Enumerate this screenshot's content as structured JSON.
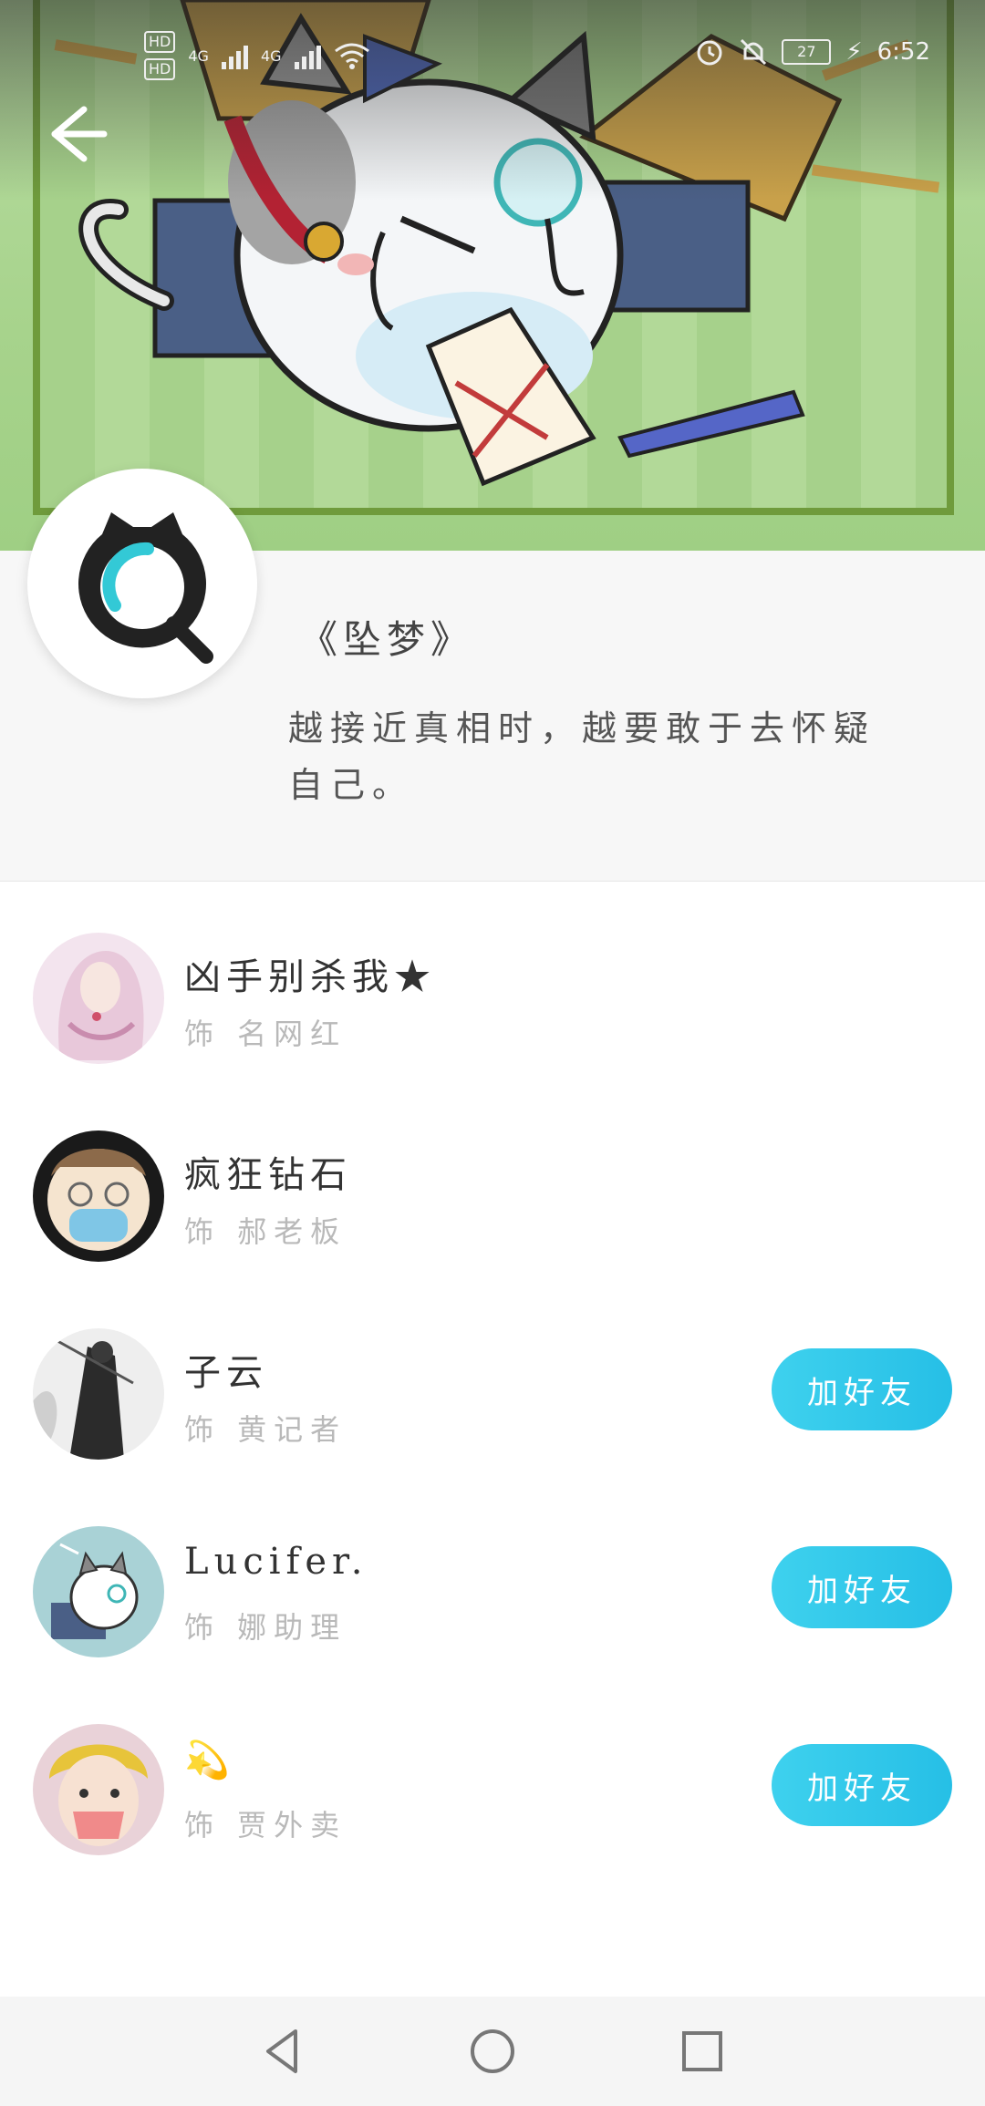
{
  "status_bar": {
    "hd1": "HD",
    "hd2": "HD",
    "net1": "4G",
    "net2": "4G",
    "battery": "27",
    "time": "6:52"
  },
  "header": {
    "back_icon": "back-arrow-icon"
  },
  "drama": {
    "title": "《坠梦》",
    "quote": "越接近真相时，越要敢于去怀疑自己。"
  },
  "cast": [
    {
      "name": "凶手别杀我★",
      "role": "饰 名网红",
      "show_add": false,
      "avatar_colors": [
        "#f3d9e6",
        "#c98cae"
      ]
    },
    {
      "name": "疯狂钻石",
      "role": "饰 郝老板",
      "show_add": false,
      "avatar_colors": [
        "#1a1a1a",
        "#f5e4cf"
      ]
    },
    {
      "name": "子云",
      "role": "饰 黄记者",
      "show_add": true,
      "add_label": "加好友",
      "avatar_colors": [
        "#eeeeee",
        "#2b2b2b"
      ]
    },
    {
      "name": "Lucifer.",
      "role": "饰 娜助理",
      "show_add": true,
      "add_label": "加好友",
      "avatar_colors": [
        "#a9d2d6",
        "#ffffff"
      ]
    },
    {
      "name": "💫",
      "role": "饰 贾外卖",
      "show_add": true,
      "add_label": "加好友",
      "avatar_colors": [
        "#e9d2d8",
        "#e7c43a"
      ]
    }
  ],
  "nav": {
    "back_icon": "triangle-back-icon",
    "home_icon": "circle-home-icon",
    "recent_icon": "square-recent-icon"
  },
  "colors": {
    "accent": "#2fc8eb",
    "banner_green": "#a7d38c"
  }
}
